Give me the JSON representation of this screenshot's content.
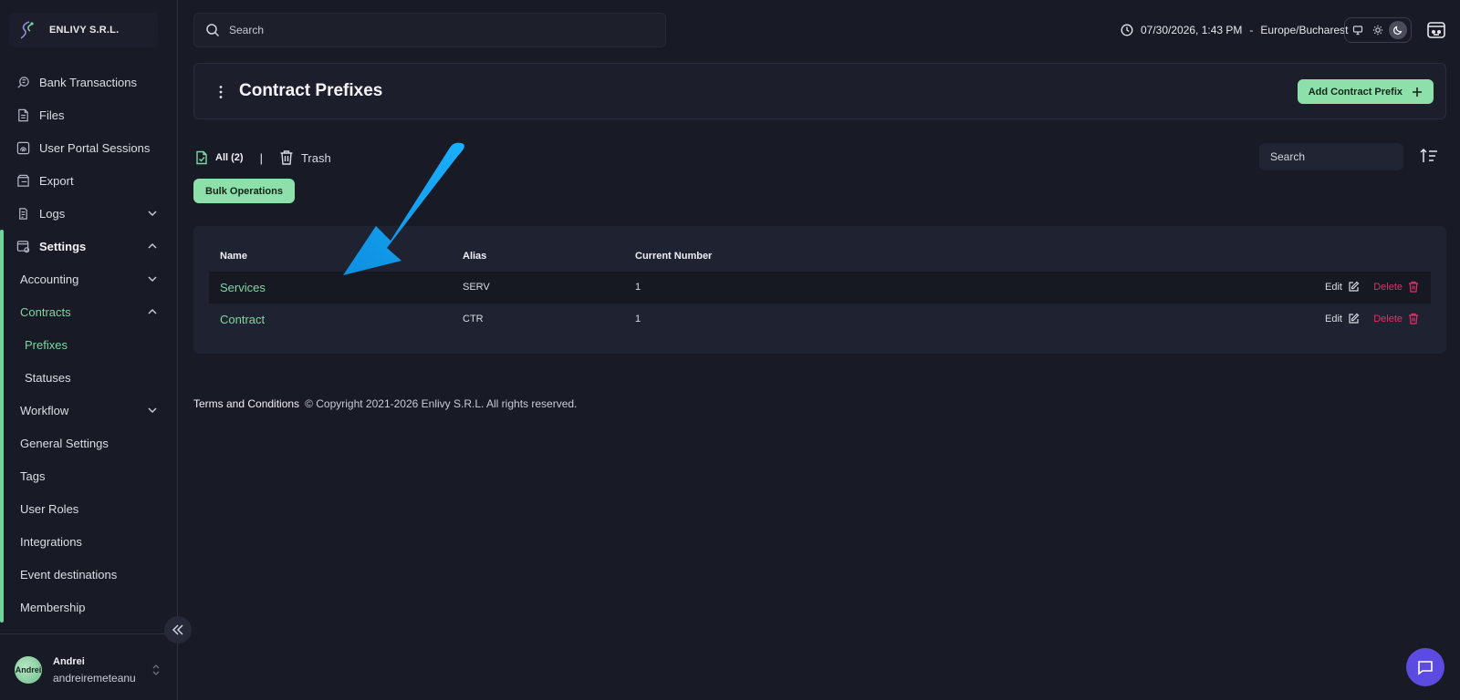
{
  "org": {
    "name": "ENLIVY S.R.L."
  },
  "sidebar": {
    "items": [
      {
        "label": "Bank Transactions",
        "icon": "bank-transactions-icon"
      },
      {
        "label": "Files",
        "icon": "file-icon"
      },
      {
        "label": "User Portal Sessions",
        "icon": "fingerprint-icon"
      },
      {
        "label": "Export",
        "icon": "export-icon"
      },
      {
        "label": "Logs",
        "icon": "logs-icon"
      },
      {
        "label": "Settings",
        "icon": "settings-icon"
      }
    ],
    "sub_items": [
      {
        "label": "Accounting"
      },
      {
        "label": "Contracts"
      },
      {
        "label": "Prefixes"
      },
      {
        "label": "Statuses"
      },
      {
        "label": "Workflow"
      },
      {
        "label": "General Settings"
      },
      {
        "label": "Tags"
      },
      {
        "label": "User Roles"
      },
      {
        "label": "Integrations"
      },
      {
        "label": "Event destinations"
      },
      {
        "label": "Membership"
      }
    ]
  },
  "user": {
    "name": "Andrei",
    "email": "andreiremeteanu",
    "avatar_text": "Andrei"
  },
  "topbar": {
    "search_placeholder": "Search",
    "datetime": "07/30/2026, 1:43 PM",
    "timezone_sep": "-",
    "timezone": "Europe/Bucharest",
    "theme_selected": "dark"
  },
  "page": {
    "title": "Contract Prefixes",
    "add_button": "Add Contract Prefix"
  },
  "filters": {
    "all_label": "All (2)",
    "separator": "|",
    "trash_label": "Trash",
    "search_placeholder": "Search",
    "bulk_button": "Bulk Operations"
  },
  "table": {
    "headers": [
      "Name",
      "Alias",
      "Current Number"
    ],
    "rows": [
      {
        "name": "Services",
        "alias": "SERV",
        "current_number": "1",
        "edit": "Edit",
        "delete": "Delete"
      },
      {
        "name": "Contract",
        "alias": "CTR",
        "current_number": "1",
        "edit": "Edit",
        "delete": "Delete"
      }
    ]
  },
  "footer": {
    "terms": "Terms and Conditions",
    "copyright": "© Copyright 2021-2026 Enlivy S.R.L. All rights reserved."
  },
  "colors": {
    "accent_green": "#8ee0ab",
    "link_green": "#7fd6a2",
    "danger": "#e0306a",
    "background": "#181a25",
    "annotation_arrow": "#1aa3f0",
    "chat_button": "#5b4be0"
  }
}
